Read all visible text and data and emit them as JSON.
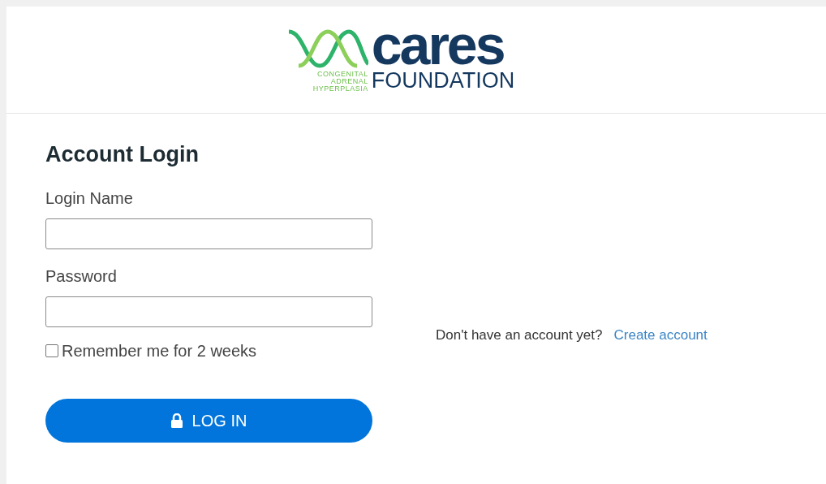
{
  "logo": {
    "word": "cares",
    "subword": "FOUNDATION",
    "tagline": [
      "CONGENITAL",
      "ADRENAL",
      "HYPERPLASIA"
    ]
  },
  "login": {
    "title": "Account Login",
    "fields": [
      {
        "label": "Login Name"
      },
      {
        "label": "Password"
      }
    ],
    "remember": {
      "label": "Remember me for 2 weeks",
      "checked": false
    },
    "button": "LOG IN"
  },
  "signup": {
    "prompt": "Don't have an account yet?",
    "link": "Create account"
  }
}
